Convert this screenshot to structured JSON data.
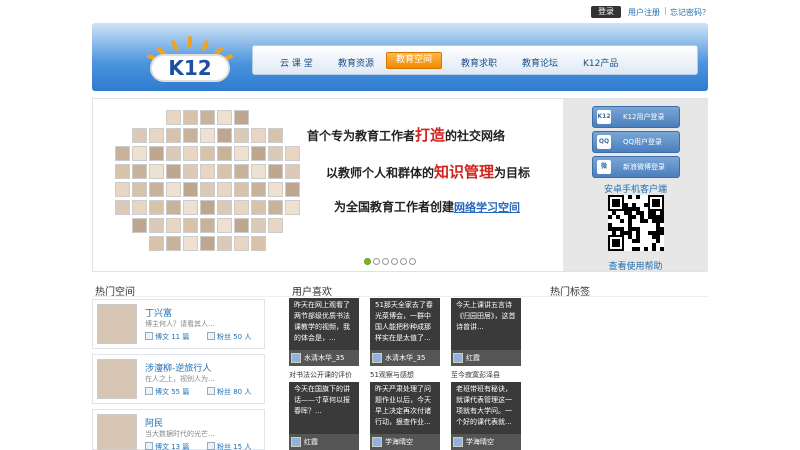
{
  "topbar": {
    "login": "登录",
    "register": "用户注册",
    "separator": "|",
    "forgot": "忘记密码？"
  },
  "logo": {
    "text": "K12"
  },
  "nav": {
    "items": [
      "云 课 堂",
      "教育资源",
      "教育空间",
      "教育求职",
      "教育论坛",
      "K12产品"
    ],
    "active_index": 2
  },
  "hero": {
    "slogan1": {
      "pre": "首个专为教育工作者",
      "hl": "打造",
      "post": "的社交网络"
    },
    "slogan2": {
      "pre": "以教师个人和群体的",
      "hl": "知识管理",
      "post": "为目标"
    },
    "slogan3": {
      "pre": "为全国教育工作者创建",
      "hl": "网络学习空间",
      "post": ""
    },
    "dot_count": 6,
    "active_dot": 0
  },
  "login_panel": {
    "buttons": [
      {
        "icon": "K12",
        "label": "K12用户登录"
      },
      {
        "icon": "QQ",
        "label": "QQ用户登录"
      },
      {
        "icon": "微",
        "label": "新浪微博登录"
      }
    ],
    "android_link": "安卓手机客户端",
    "help_link": "查看使用帮助"
  },
  "sections": {
    "hot_spaces": "热门空间",
    "favorites": "用户喜欢",
    "hot_tags": "热门标签"
  },
  "hot_spaces": [
    {
      "name": "丁兴富",
      "desc": "博主何人？请看其人...",
      "posts": "博文 11 篇",
      "fans": "粉丝 50 人"
    },
    {
      "name": "涉濅柳-逆旅行人",
      "desc": "在人之上，视别人为...",
      "posts": "博文 55 篇",
      "fans": "粉丝 80 人"
    },
    {
      "name": "阿民",
      "desc": "当大数据时代的光芒...",
      "posts": "博文 13 篇",
      "fans": "粉丝 15 人"
    }
  ],
  "favorites": [
    {
      "text": "昨天在网上观看了两节部级优质书法课教学的视频，我的体会是，...",
      "user": "水清木华_35",
      "caption": "对书法公开课的评价"
    },
    {
      "text": "51那天全家去了春光菜博会，一群中国人能把秒种成那样实在是太值了...",
      "user": "水清木华_35",
      "caption": "51观察与感想"
    },
    {
      "text": "今天上课讲五言诗《归园田居》，这首诗曾讲...",
      "user": "红霞",
      "caption": "至今寂寞彭泽县"
    },
    {
      "text": "今天在国旗下的讲话——寸草何以报春晖？...",
      "user": "红霞",
      "caption": ""
    },
    {
      "text": "昨天严肃处理了问题作业以后，今天早上决定再次付诸行动，狠查作业...",
      "user": "学海晴空",
      "caption": ""
    },
    {
      "text": "老班带班有秘诀，就课代表管理这一项就有大学问。一个好的课代表就...",
      "user": "学海晴空",
      "caption": ""
    }
  ],
  "colors": {
    "accent": "#1d6fb5",
    "nav_active": "#f08a00",
    "header": "#2f7bcf"
  }
}
